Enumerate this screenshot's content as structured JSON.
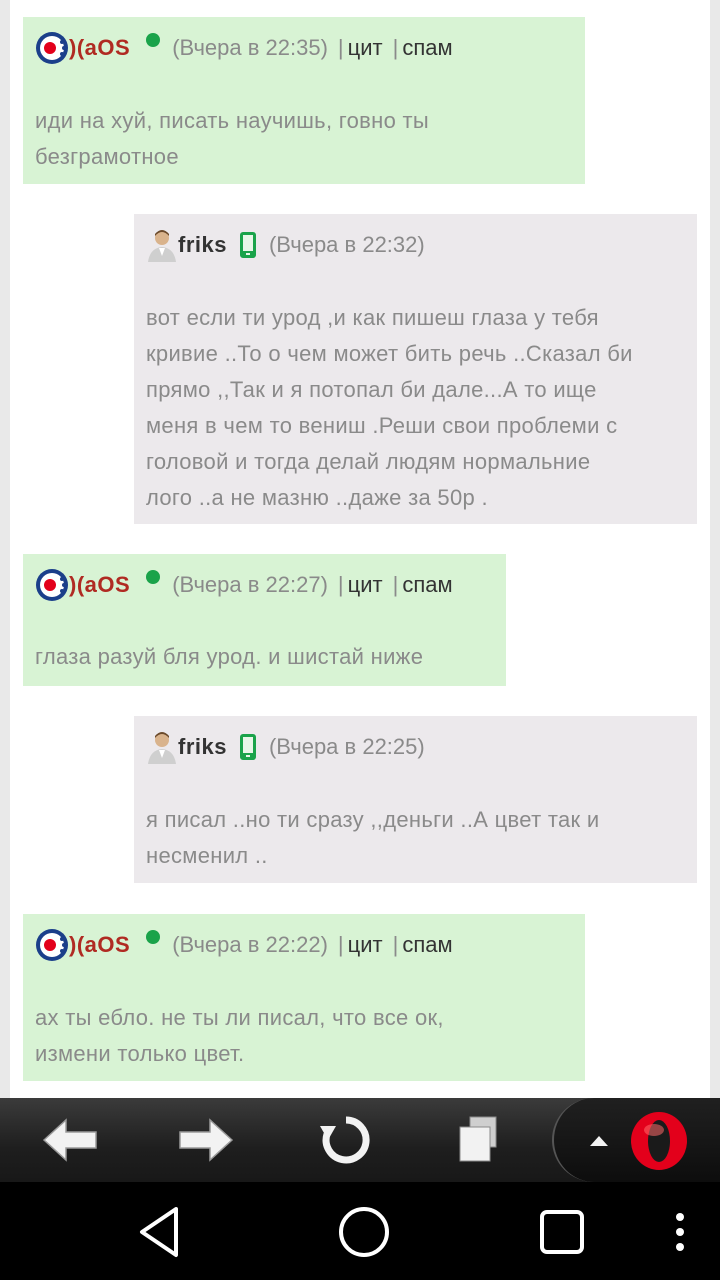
{
  "messages": [
    {
      "author": ")(aOS",
      "time": "(Вчера в 22:35)",
      "cite": "цит",
      "spam": "спам",
      "lines": [
        "иди на хуй, писать научишь, говно ты",
        "безграмотное"
      ]
    },
    {
      "author": "friks",
      "time": "(Вчера в 22:32)",
      "lines": [
        "вот если ти урод ,и как пишеш глаза у тебя",
        "кривие ..То о чем может бить речь ..Сказал би",
        "прямо ,,Так и я потопал би дале...А то ище",
        "меня в чем то вениш .Реши свои проблеми с",
        "головой и тогда делай людям нормальние",
        "лого ..а не мазню ..даже за 50р ."
      ]
    },
    {
      "author": ")(aOS",
      "time": "(Вчера в 22:27)",
      "cite": "цит",
      "spam": "спам",
      "lines": [
        "глаза разуй бля урод. и шистай ниже"
      ]
    },
    {
      "author": "friks",
      "time": "(Вчера в 22:25)",
      "lines": [
        "я писал ..но ти сразу ,,деньги ..А цвет так и",
        "несменил .."
      ]
    },
    {
      "author": ")(aOS",
      "time": "(Вчера в 22:22)",
      "cite": "цит",
      "spam": "спам",
      "lines": [
        "ах ты ебло. не ты ли писал, что все ок,",
        "измени только цвет."
      ]
    }
  ],
  "icons": {
    "author_logo": "aos-logo-icon",
    "user_avatar": "user-icon",
    "online_status": "online-dot-icon",
    "mobile_status": "mobile-phone-icon",
    "toolbar": [
      "back-arrow-icon",
      "forward-arrow-icon",
      "reload-icon",
      "tabs-icon",
      "menu-up-icon",
      "opera-logo-icon"
    ],
    "navbar": [
      "back-triangle-icon",
      "home-circle-icon",
      "recents-square-icon",
      "overflow-dots-icon"
    ]
  },
  "colors": {
    "own_bubble": "#d8f3d4",
    "other_bubble": "#ece9ec",
    "author_red": "#b02a22",
    "online_green": "#1aa34a",
    "opera_red": "#e3001b"
  }
}
